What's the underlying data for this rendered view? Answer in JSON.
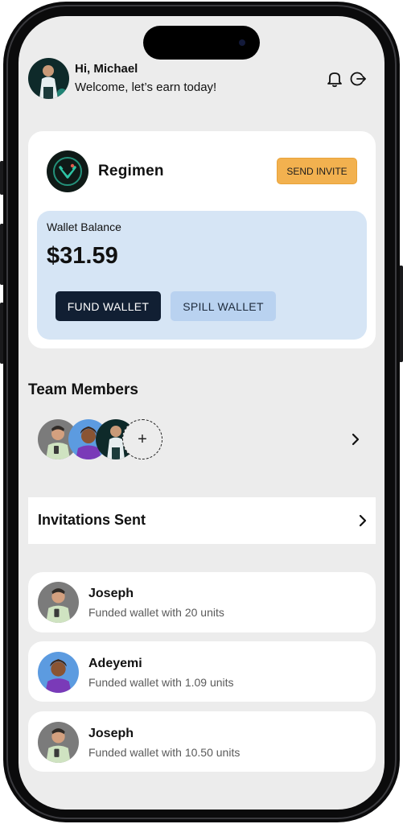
{
  "header": {
    "greeting": "Hi, Michael",
    "subtitle": "Welcome, let’s earn today!",
    "icons": [
      "bell-icon",
      "logout-icon"
    ]
  },
  "wallet_card": {
    "brand_name": "Regimen",
    "send_invite_label": "SEND INVITE",
    "balance_label": "Wallet Balance",
    "balance_value": "$31.59",
    "fund_label": "FUND WALLET",
    "spill_label": "SPILL WALLET"
  },
  "team": {
    "title": "Team Members",
    "add_label": "+"
  },
  "invitations": {
    "label": "Invitations Sent"
  },
  "activity": [
    {
      "name": "Joseph",
      "desc": "Funded wallet with 20 units"
    },
    {
      "name": "Adeyemi",
      "desc": "Funded wallet with 1.09 units"
    },
    {
      "name": "Joseph",
      "desc": "Funded wallet with 10.50 units"
    }
  ],
  "colors": {
    "accent": "#f2b14f",
    "navy": "#111f33",
    "balance_bg": "#d6e5f5",
    "screen_bg": "#ececec"
  }
}
